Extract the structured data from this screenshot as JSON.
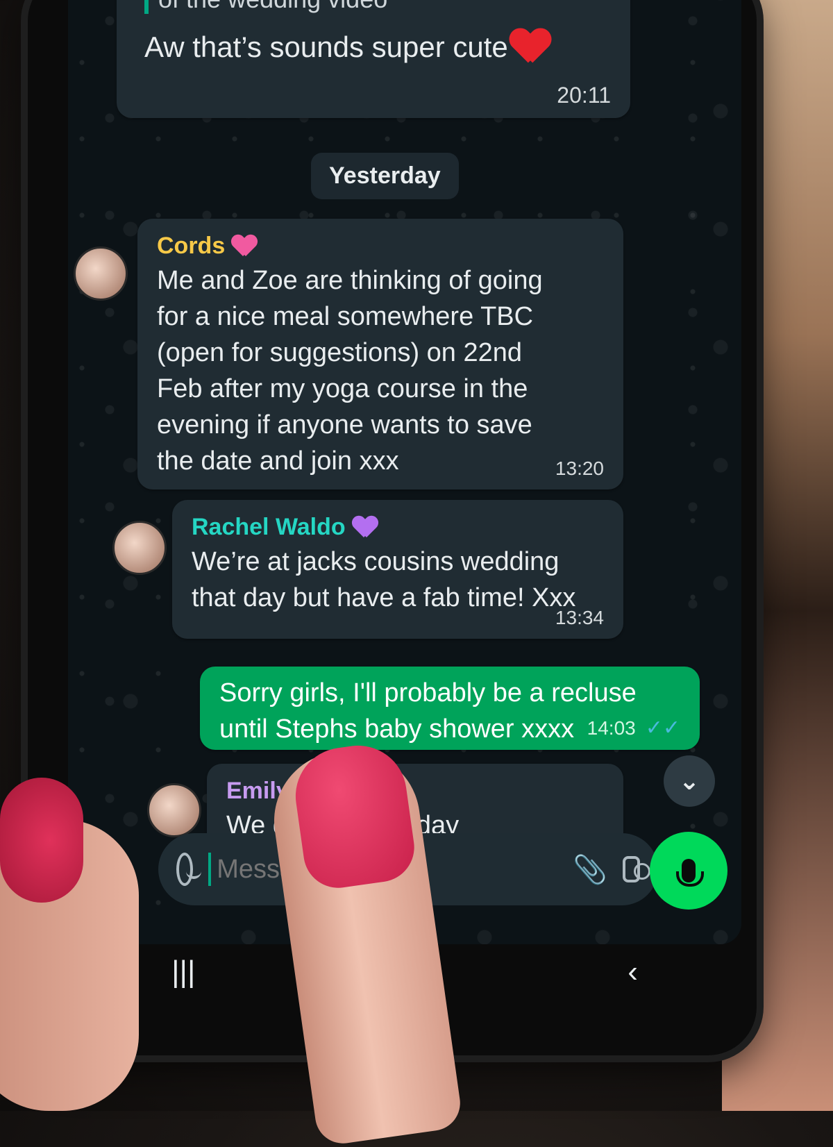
{
  "messages": {
    "top": {
      "text": "Aw that’s sounds super cute",
      "quote_fragment": "of the wedding video",
      "time": "20:11"
    },
    "date_chip": "Yesterday",
    "cords": {
      "sender": "Cords",
      "text": "Me and Zoe are thinking of going\nfor a nice meal somewhere TBC\n(open for suggestions) on 22nd\nFeb after my yoga course in the\nevening if anyone wants to save\nthe date and join xxx",
      "time": "13:20"
    },
    "rachel": {
      "sender": "Rachel Waldo",
      "text": "We’re at jacks cousins wedding\nthat day but have a fab time! Xxx",
      "time": "13:34"
    },
    "sent": {
      "text": "Sorry girls, I'll probably be a recluse\nuntil Stephs baby shower xxxx",
      "time": "14:03"
    },
    "emily": {
      "sender": "Emily Ban",
      "text": "We get b                    is that day\nbut thanl                   Xx"
    }
  },
  "composer": {
    "placeholder": "Message"
  },
  "colors": {
    "accent_green": "#00d95a",
    "sent_bubble": "#00a35a",
    "incoming_bubble": "#202c33",
    "sender_cords": "#f7c948",
    "sender_rachel": "#25d6c3",
    "sender_emily": "#c79bf0",
    "read_ticks": "#53bdeb"
  },
  "icons": [
    "emoji-icon",
    "attach-icon",
    "camera-icon",
    "mic-icon",
    "double-chevron-down-icon",
    "recents-icon",
    "back-icon"
  ]
}
